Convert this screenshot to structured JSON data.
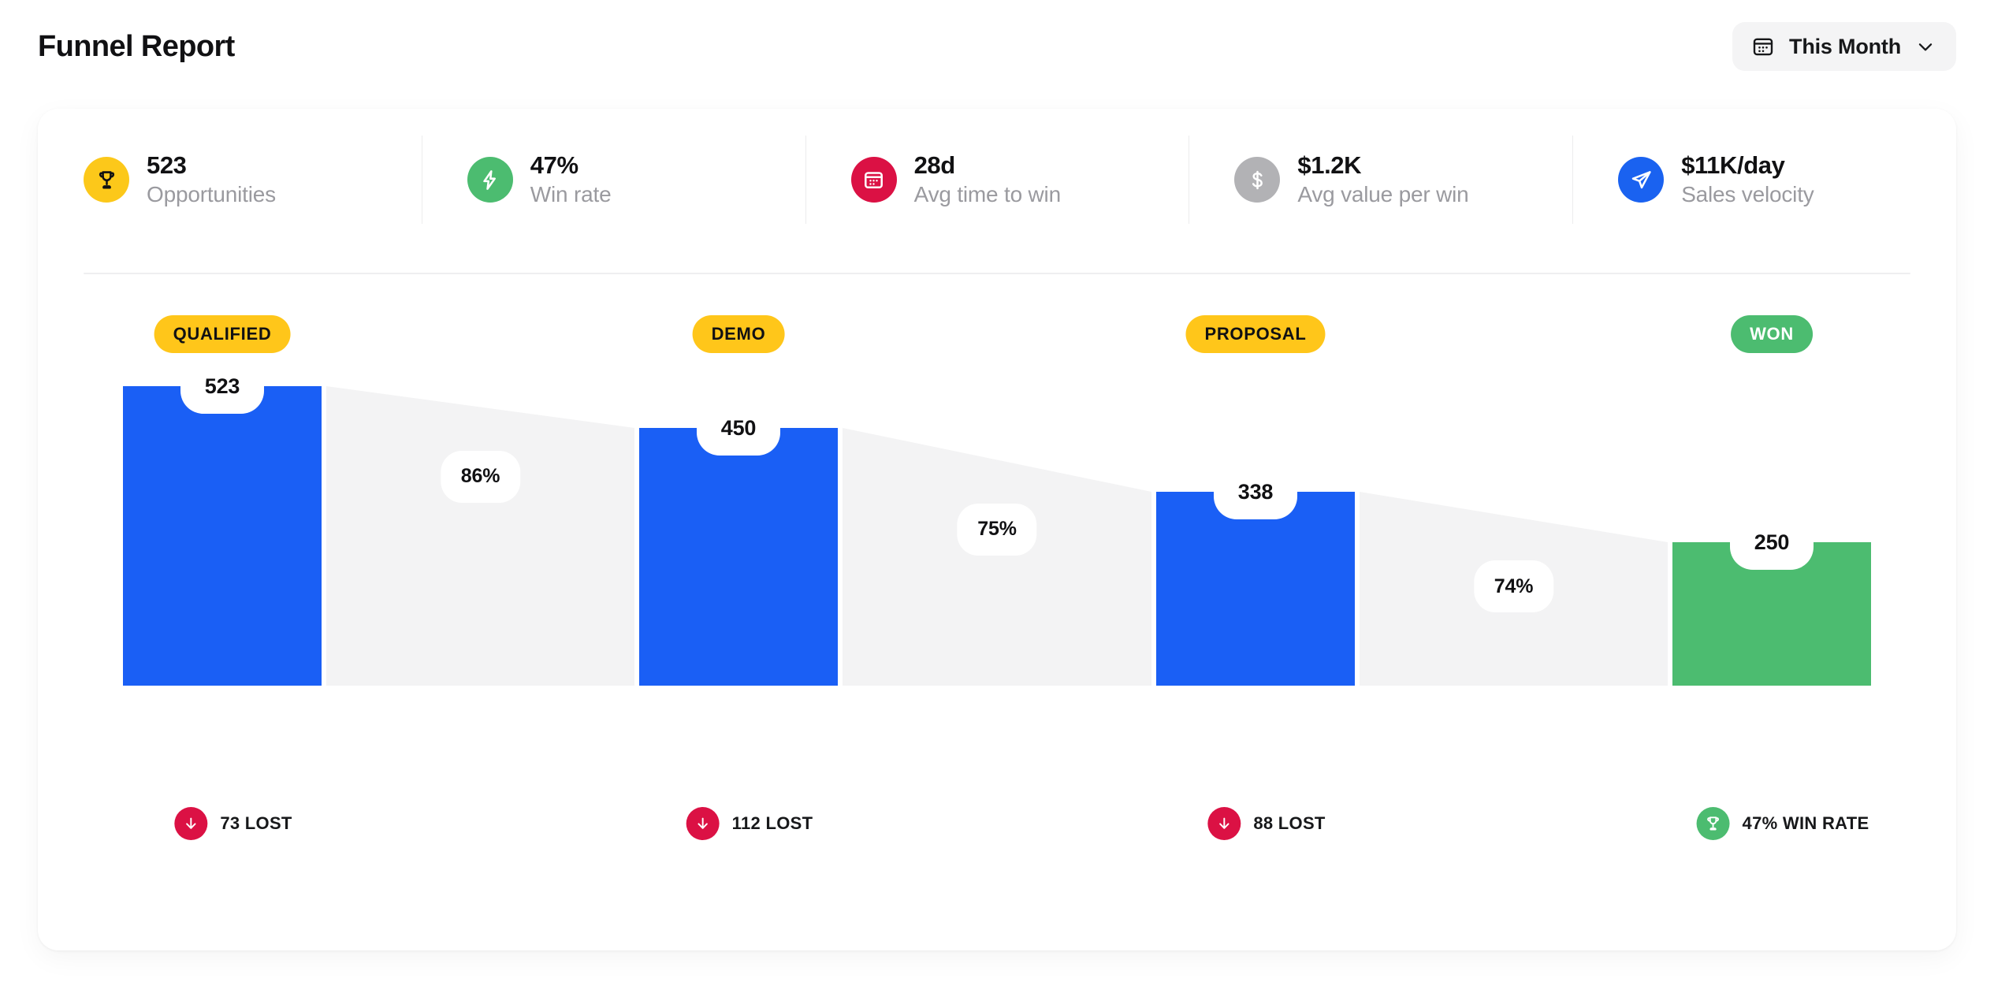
{
  "header": {
    "title": "Funnel Report",
    "range_picker": {
      "label": "This Month",
      "calendar_icon": "calendar-icon",
      "chevron_icon": "chevron-down-icon"
    }
  },
  "kpis": [
    {
      "value": "523",
      "label": "Opportunities",
      "icon": "trophy-icon",
      "badge_color": "#FCC81A",
      "icon_color": "#111113"
    },
    {
      "value": "47%",
      "label": "Win rate",
      "icon": "lightning-icon",
      "badge_color": "#4CBC70",
      "icon_color": "#ffffff"
    },
    {
      "value": "28d",
      "label": "Avg time to win",
      "icon": "calendar-icon",
      "badge_color": "#DB1144",
      "icon_color": "#ffffff"
    },
    {
      "value": "$1.2K",
      "label": "Avg value per win",
      "icon": "dollar-icon",
      "badge_color": "#B2B2B5",
      "icon_color": "#ffffff"
    },
    {
      "value": "$11K/day",
      "label": "Sales velocity",
      "icon": "send-icon",
      "badge_color": "#1A62F0",
      "icon_color": "#ffffff"
    }
  ],
  "colors": {
    "bar_blue": "#1A5FF5",
    "bar_green": "#4CBC70",
    "connector_gray": "#F3F3F4",
    "pill_yellow": "#FFC61A",
    "pill_green": "#4CBC70",
    "lost_red": "#DB1144",
    "text_dark": "#111113",
    "text_muted": "#9A9A9F",
    "card_white": "#FFFFFF"
  },
  "chart_data": {
    "type": "bar",
    "title": "Funnel Report",
    "xlabel": "",
    "ylabel": "",
    "grid": false,
    "legend": "none",
    "ylim": [
      0,
      523
    ],
    "categories": [
      "QUALIFIED",
      "DEMO",
      "PROPOSAL",
      "WON"
    ],
    "values": [
      523,
      450,
      338,
      250
    ],
    "series": [
      {
        "name": "Opportunities",
        "values": [
          523,
          450,
          338,
          250
        ]
      }
    ],
    "stages": [
      {
        "name": "QUALIFIED",
        "value": 523,
        "pill_bg": "#FFC61A",
        "pill_fg": "#111113",
        "bar_color": "#1A5FF5",
        "footer": {
          "text": "73 LOST",
          "icon": "arrow-down-icon",
          "badge_color": "#DB1144"
        }
      },
      {
        "name": "DEMO",
        "value": 450,
        "pill_bg": "#FFC61A",
        "pill_fg": "#111113",
        "bar_color": "#1A5FF5",
        "footer": {
          "text": "112 LOST",
          "icon": "arrow-down-icon",
          "badge_color": "#DB1144"
        }
      },
      {
        "name": "PROPOSAL",
        "value": 338,
        "pill_bg": "#FFC61A",
        "pill_fg": "#111113",
        "bar_color": "#1A5FF5",
        "footer": {
          "text": "88 LOST",
          "icon": "arrow-down-icon",
          "badge_color": "#DB1144"
        }
      },
      {
        "name": "WON",
        "value": 250,
        "pill_bg": "#4CBC70",
        "pill_fg": "#FFFFFF",
        "bar_color": "#4CBC70",
        "footer": {
          "text": "47% WIN RATE",
          "icon": "trophy-icon",
          "badge_color": "#4CBC70"
        }
      }
    ],
    "conversions": [
      {
        "label": "86%",
        "from": "QUALIFIED",
        "to": "DEMO"
      },
      {
        "label": "75%",
        "from": "DEMO",
        "to": "PROPOSAL"
      },
      {
        "label": "74%",
        "from": "PROPOSAL",
        "to": "WON"
      }
    ],
    "annotations": [
      "523 Opportunities",
      "47% Win rate",
      "28d Avg time to win",
      "$1.2K Avg value per win",
      "$11K/day Sales velocity"
    ]
  }
}
